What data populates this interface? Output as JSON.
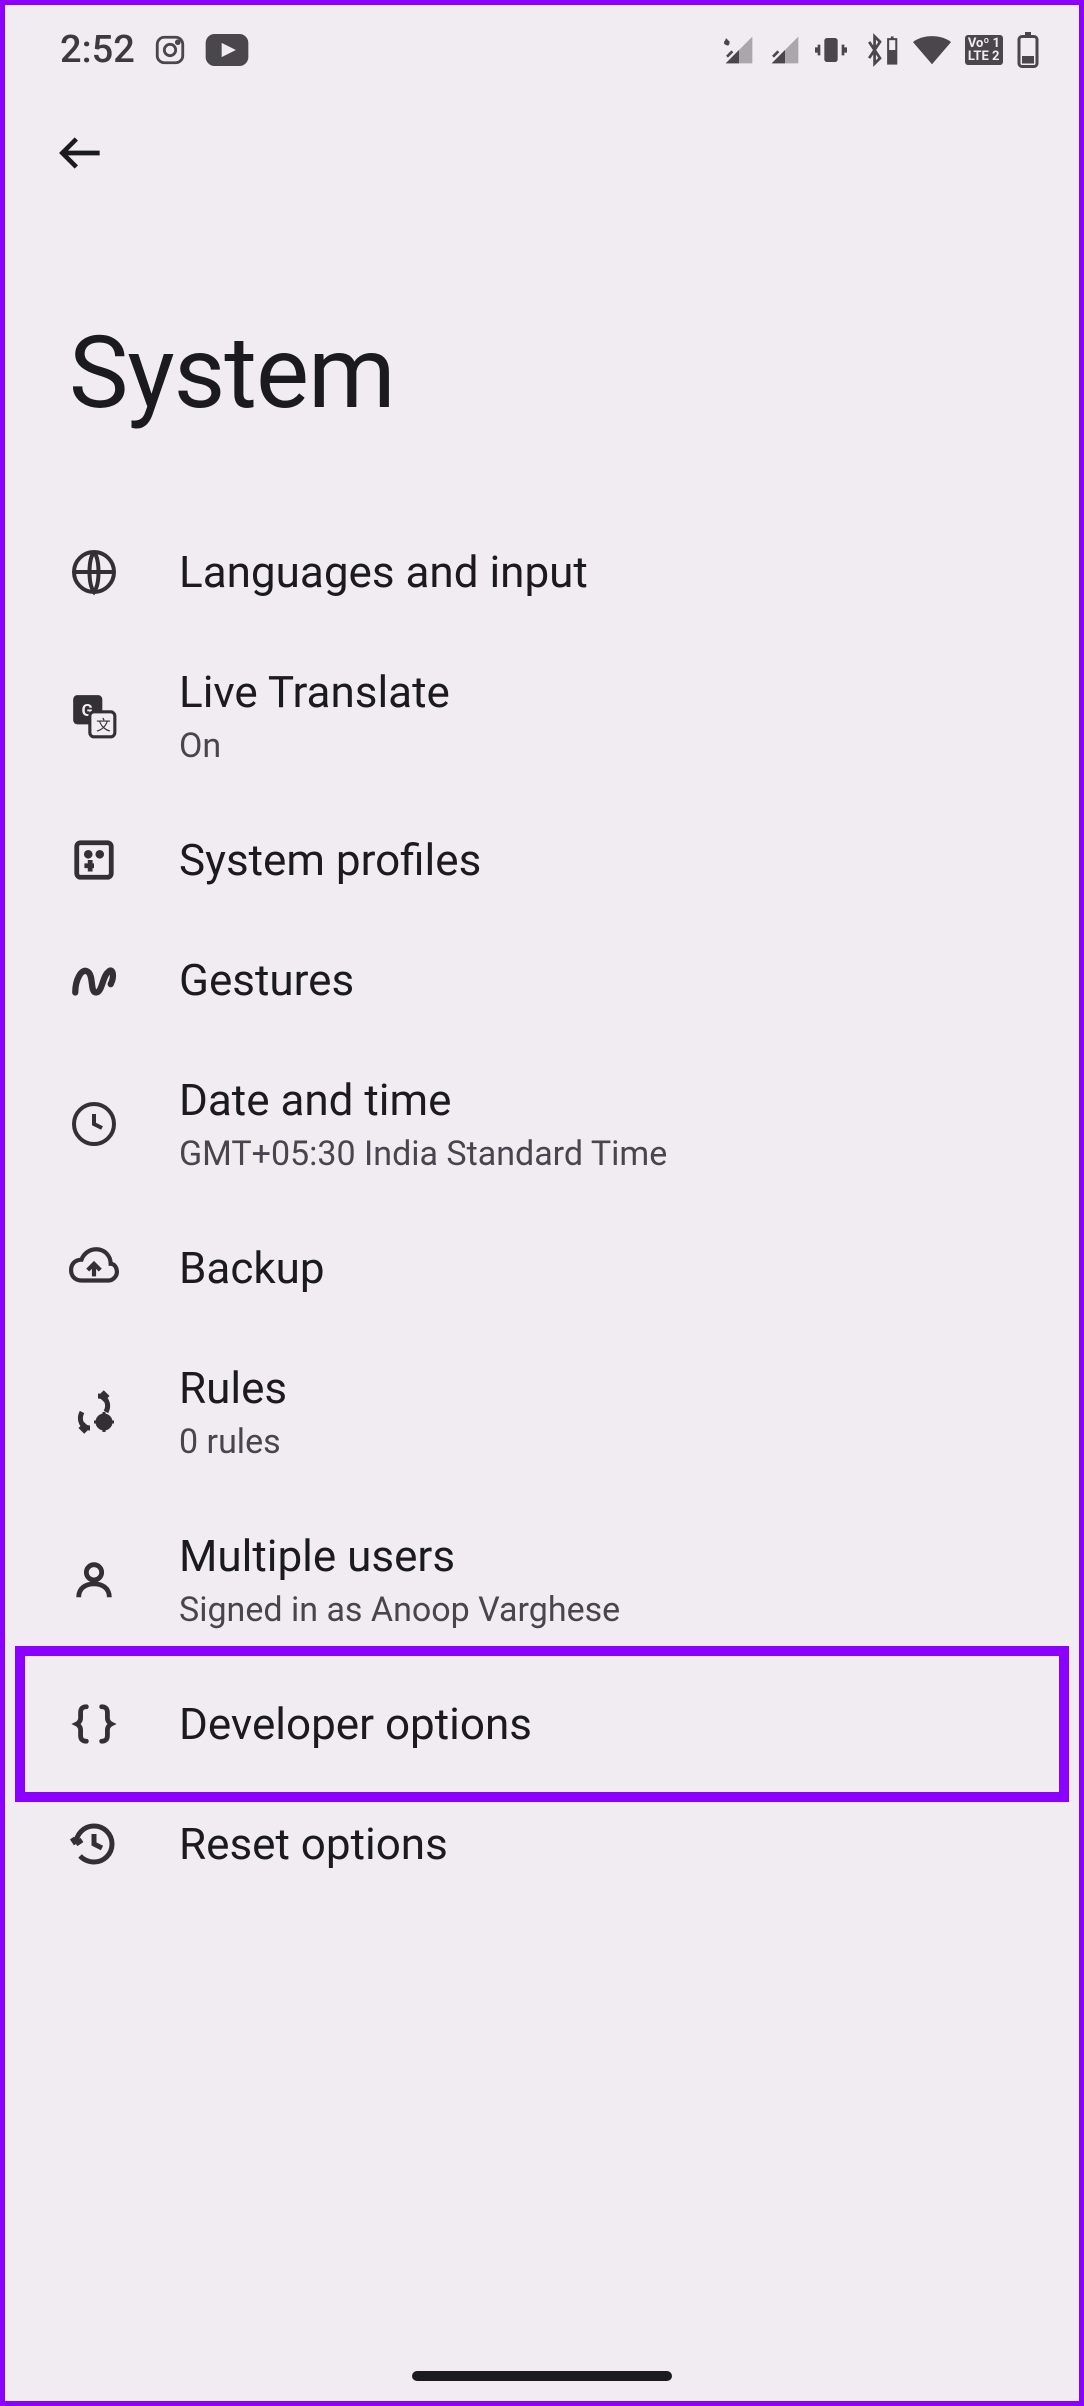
{
  "status": {
    "time": "2:52"
  },
  "page": {
    "title": "System"
  },
  "items": [
    {
      "title": "Languages and input",
      "subtitle": ""
    },
    {
      "title": "Live Translate",
      "subtitle": "On"
    },
    {
      "title": "System profiles",
      "subtitle": ""
    },
    {
      "title": "Gestures",
      "subtitle": ""
    },
    {
      "title": "Date and time",
      "subtitle": "GMT+05:30 India Standard Time"
    },
    {
      "title": "Backup",
      "subtitle": ""
    },
    {
      "title": "Rules",
      "subtitle": "0 rules"
    },
    {
      "title": "Multiple users",
      "subtitle": "Signed in as Anoop Varghese"
    },
    {
      "title": "Developer options",
      "subtitle": ""
    },
    {
      "title": "Reset options",
      "subtitle": ""
    }
  ],
  "volte": {
    "line1": "Voº 1",
    "line2": "LTE 2"
  }
}
